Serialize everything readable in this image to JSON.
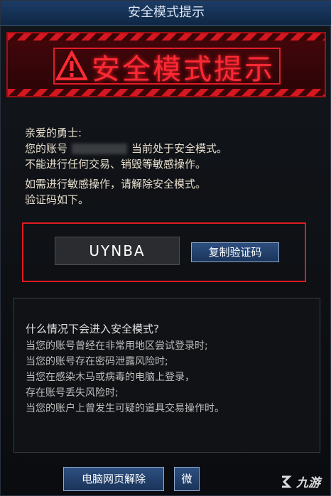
{
  "window": {
    "title": "安全模式提示"
  },
  "banner": {
    "title": "安全模式提示",
    "icon": "warning-triangle-icon"
  },
  "greeting": {
    "salutation": "亲爱的勇士:",
    "line2_prefix": "您的账号",
    "line2_suffix": "当前处于安全模式。",
    "line3": "不能进行任何交易、销毁等敏感操作。",
    "line4": "如需进行敏感操作，请解除安全模式。",
    "line5": "验证码如下。"
  },
  "verification": {
    "code": "UYNBA",
    "copy_label": "复制验证码"
  },
  "info": {
    "heading": "什么情况下会进入安全模式?",
    "items": [
      "当您的账号曾经在非常用地区尝试登录时;",
      "当您的账号存在密码泄露风险时;",
      "当您在感染木马或病毒的电脑上登录，",
      "存在账号丢失风险时;",
      "当您的账户上曾发生可疑的道具交易操作时。"
    ]
  },
  "buttons": {
    "web_unlock": "电脑网页解除",
    "wechat_partial": "微"
  },
  "watermark": {
    "text": "九游"
  },
  "colors": {
    "accent_red": "#e01b22",
    "button_blue": "#1a345a",
    "title_blue": "#1c3c66"
  }
}
